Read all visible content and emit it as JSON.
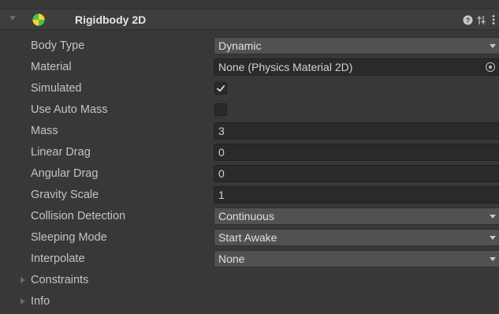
{
  "component": {
    "title": "Rigidbody 2D",
    "icon": "rigidbody2d-icon",
    "header_buttons": [
      "help-icon",
      "preset-sliders-icon",
      "kebab-menu-icon"
    ]
  },
  "properties": {
    "body_type": {
      "label": "Body Type",
      "value": "Dynamic"
    },
    "material": {
      "label": "Material",
      "value": "None (Physics Material 2D)"
    },
    "simulated": {
      "label": "Simulated",
      "checked": true
    },
    "use_auto_mass": {
      "label": "Use Auto Mass",
      "checked": false
    },
    "mass": {
      "label": "Mass",
      "value": "3"
    },
    "linear_drag": {
      "label": "Linear Drag",
      "value": "0"
    },
    "angular_drag": {
      "label": "Angular Drag",
      "value": "0"
    },
    "gravity_scale": {
      "label": "Gravity Scale",
      "value": "1"
    },
    "collision_detection": {
      "label": "Collision Detection",
      "value": "Continuous"
    },
    "sleeping_mode": {
      "label": "Sleeping Mode",
      "value": "Start Awake"
    },
    "interpolate": {
      "label": "Interpolate",
      "value": "None"
    }
  },
  "foldouts": {
    "constraints": {
      "label": "Constraints"
    },
    "info": {
      "label": "Info"
    }
  },
  "colors": {
    "panel_bg": "#383838",
    "field_bg": "#2a2a2a",
    "dropdown_bg": "#515151",
    "icon_green": "#4cc24c",
    "icon_yellow": "#f2d23a"
  }
}
